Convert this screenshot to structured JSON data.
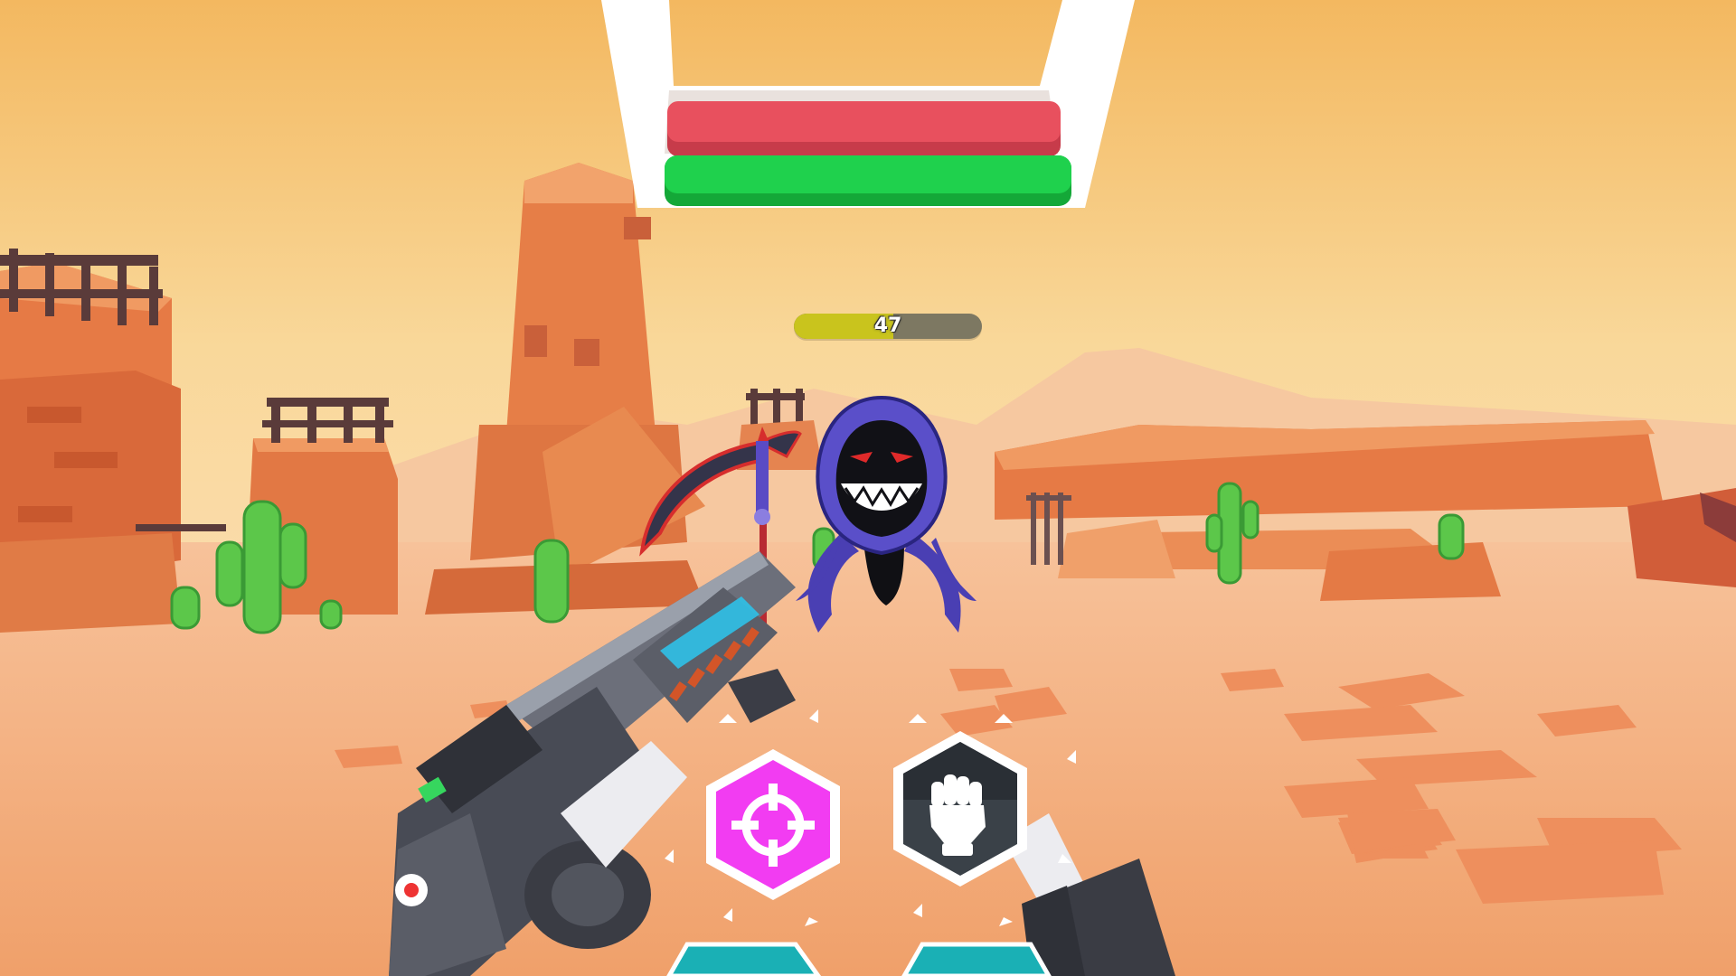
{
  "enemy": {
    "health_value": "47",
    "health_fraction": 0.53
  },
  "player_bars": {
    "red_fill": 1.0,
    "green_fill": 1.0
  },
  "abilities": [
    {
      "icon": "crosshair-icon",
      "color": "#f23cf2",
      "state": "ready"
    },
    {
      "icon": "fist-icon",
      "color": "#3a4148",
      "state": "cooldown"
    }
  ],
  "colors": {
    "sky": "#f7d27f",
    "sand": "#f1a56a",
    "rock": "#e2844c",
    "health_red": "#e8505e",
    "health_green": "#1fd14d",
    "enemy_hp_yellow": "#c9c41d",
    "ability_magenta": "#f23cf2",
    "ability_teal": "#1ab0b5"
  }
}
